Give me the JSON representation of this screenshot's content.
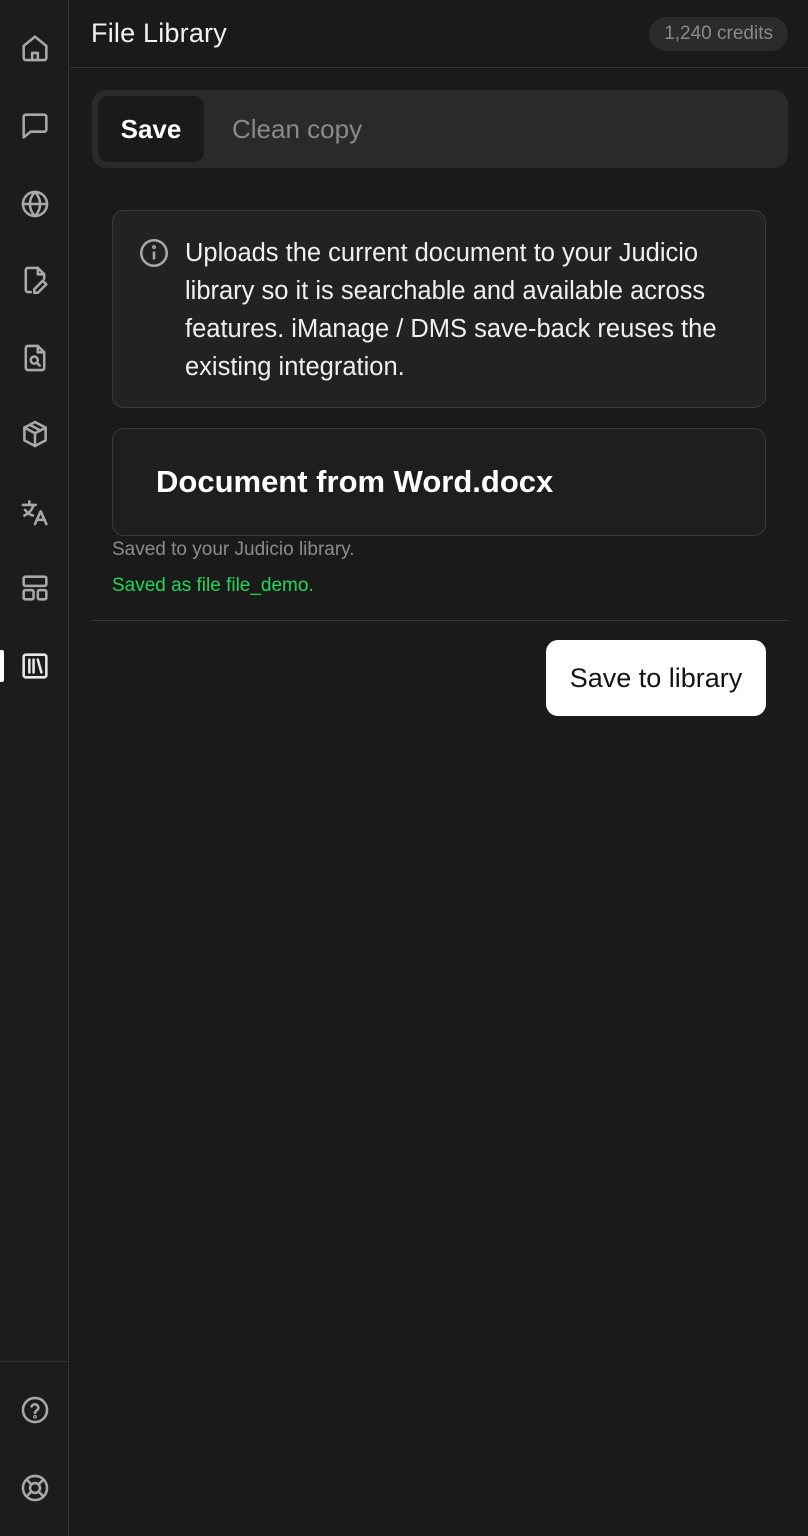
{
  "header": {
    "title": "File Library",
    "credits": "1,240 credits"
  },
  "sidebar": {
    "items": [
      {
        "icon": "home-icon"
      },
      {
        "icon": "chat-icon"
      },
      {
        "icon": "globe-icon"
      },
      {
        "icon": "edit-document-icon"
      },
      {
        "icon": "search-document-icon"
      },
      {
        "icon": "cube-icon"
      },
      {
        "icon": "translate-icon"
      },
      {
        "icon": "layout-icon"
      },
      {
        "icon": "library-icon",
        "active": true
      }
    ],
    "bottom_items": [
      {
        "icon": "help-icon"
      },
      {
        "icon": "support-lifebuoy-icon"
      }
    ]
  },
  "tabs": [
    {
      "label": "Save",
      "active": true
    },
    {
      "label": "Clean copy",
      "active": false
    }
  ],
  "info": {
    "text": "Uploads the current document to your Judicio library so it is searchable and available across features. iManage / DMS save-back reuses the existing integration."
  },
  "file": {
    "name": "Document from Word.docx",
    "helper": "Saved to your Judicio library.",
    "status": "Saved as file file_demo."
  },
  "actions": {
    "save_label": "Save to library"
  },
  "colors": {
    "background": "#1a1a1a",
    "success": "#22d65a",
    "primary_button_bg": "#ffffff"
  }
}
